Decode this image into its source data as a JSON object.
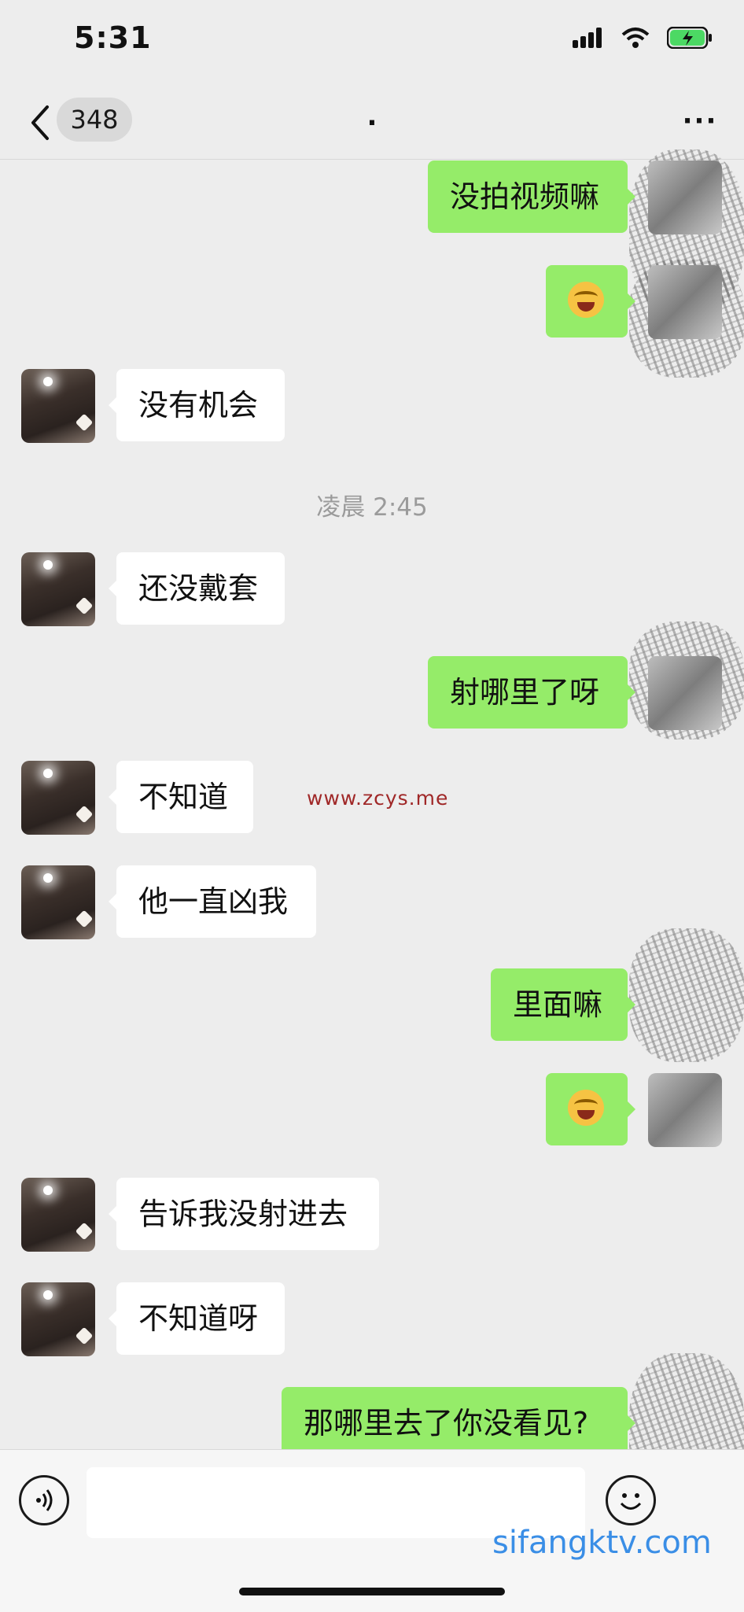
{
  "status": {
    "time": "5:31",
    "signal_icon": "cellular-signal-icon",
    "wifi_icon": "wifi-icon",
    "battery_icon": "battery-charging-icon",
    "battery_color": "#4cd964"
  },
  "header": {
    "unread_count": "348",
    "title": ".",
    "back_icon": "chevron-left-icon",
    "more_icon": "ellipsis-icon",
    "more_label": "···"
  },
  "messages": [
    {
      "side": "out",
      "text": "没拍视频嘛"
    },
    {
      "side": "out",
      "emoji": "face-with-tears-of-joy"
    },
    {
      "side": "in",
      "text": "没有机会"
    },
    {
      "side": "in",
      "text": "还没戴套"
    },
    {
      "side": "out",
      "text": "射哪里了呀"
    },
    {
      "side": "in",
      "text": "不知道"
    },
    {
      "side": "in",
      "text": "他一直凶我"
    },
    {
      "side": "out",
      "text": "里面嘛"
    },
    {
      "side": "out",
      "emoji": "face-with-tears-of-joy"
    },
    {
      "side": "in",
      "text": "告诉我没射进去"
    },
    {
      "side": "in",
      "text": "不知道呀"
    },
    {
      "side": "out",
      "text": "那哪里去了你没看见?"
    }
  ],
  "time_divider": "凌晨 2:45",
  "watermarks": {
    "url": "www.zcys.me",
    "site": "sifangktv.com"
  },
  "input": {
    "voice_icon": "voice-icon",
    "emoji_icon": "smiley-icon",
    "value": ""
  },
  "colors": {
    "background": "#ededed",
    "outgoing_bubble": "#95ec69",
    "incoming_bubble": "#ffffff"
  }
}
